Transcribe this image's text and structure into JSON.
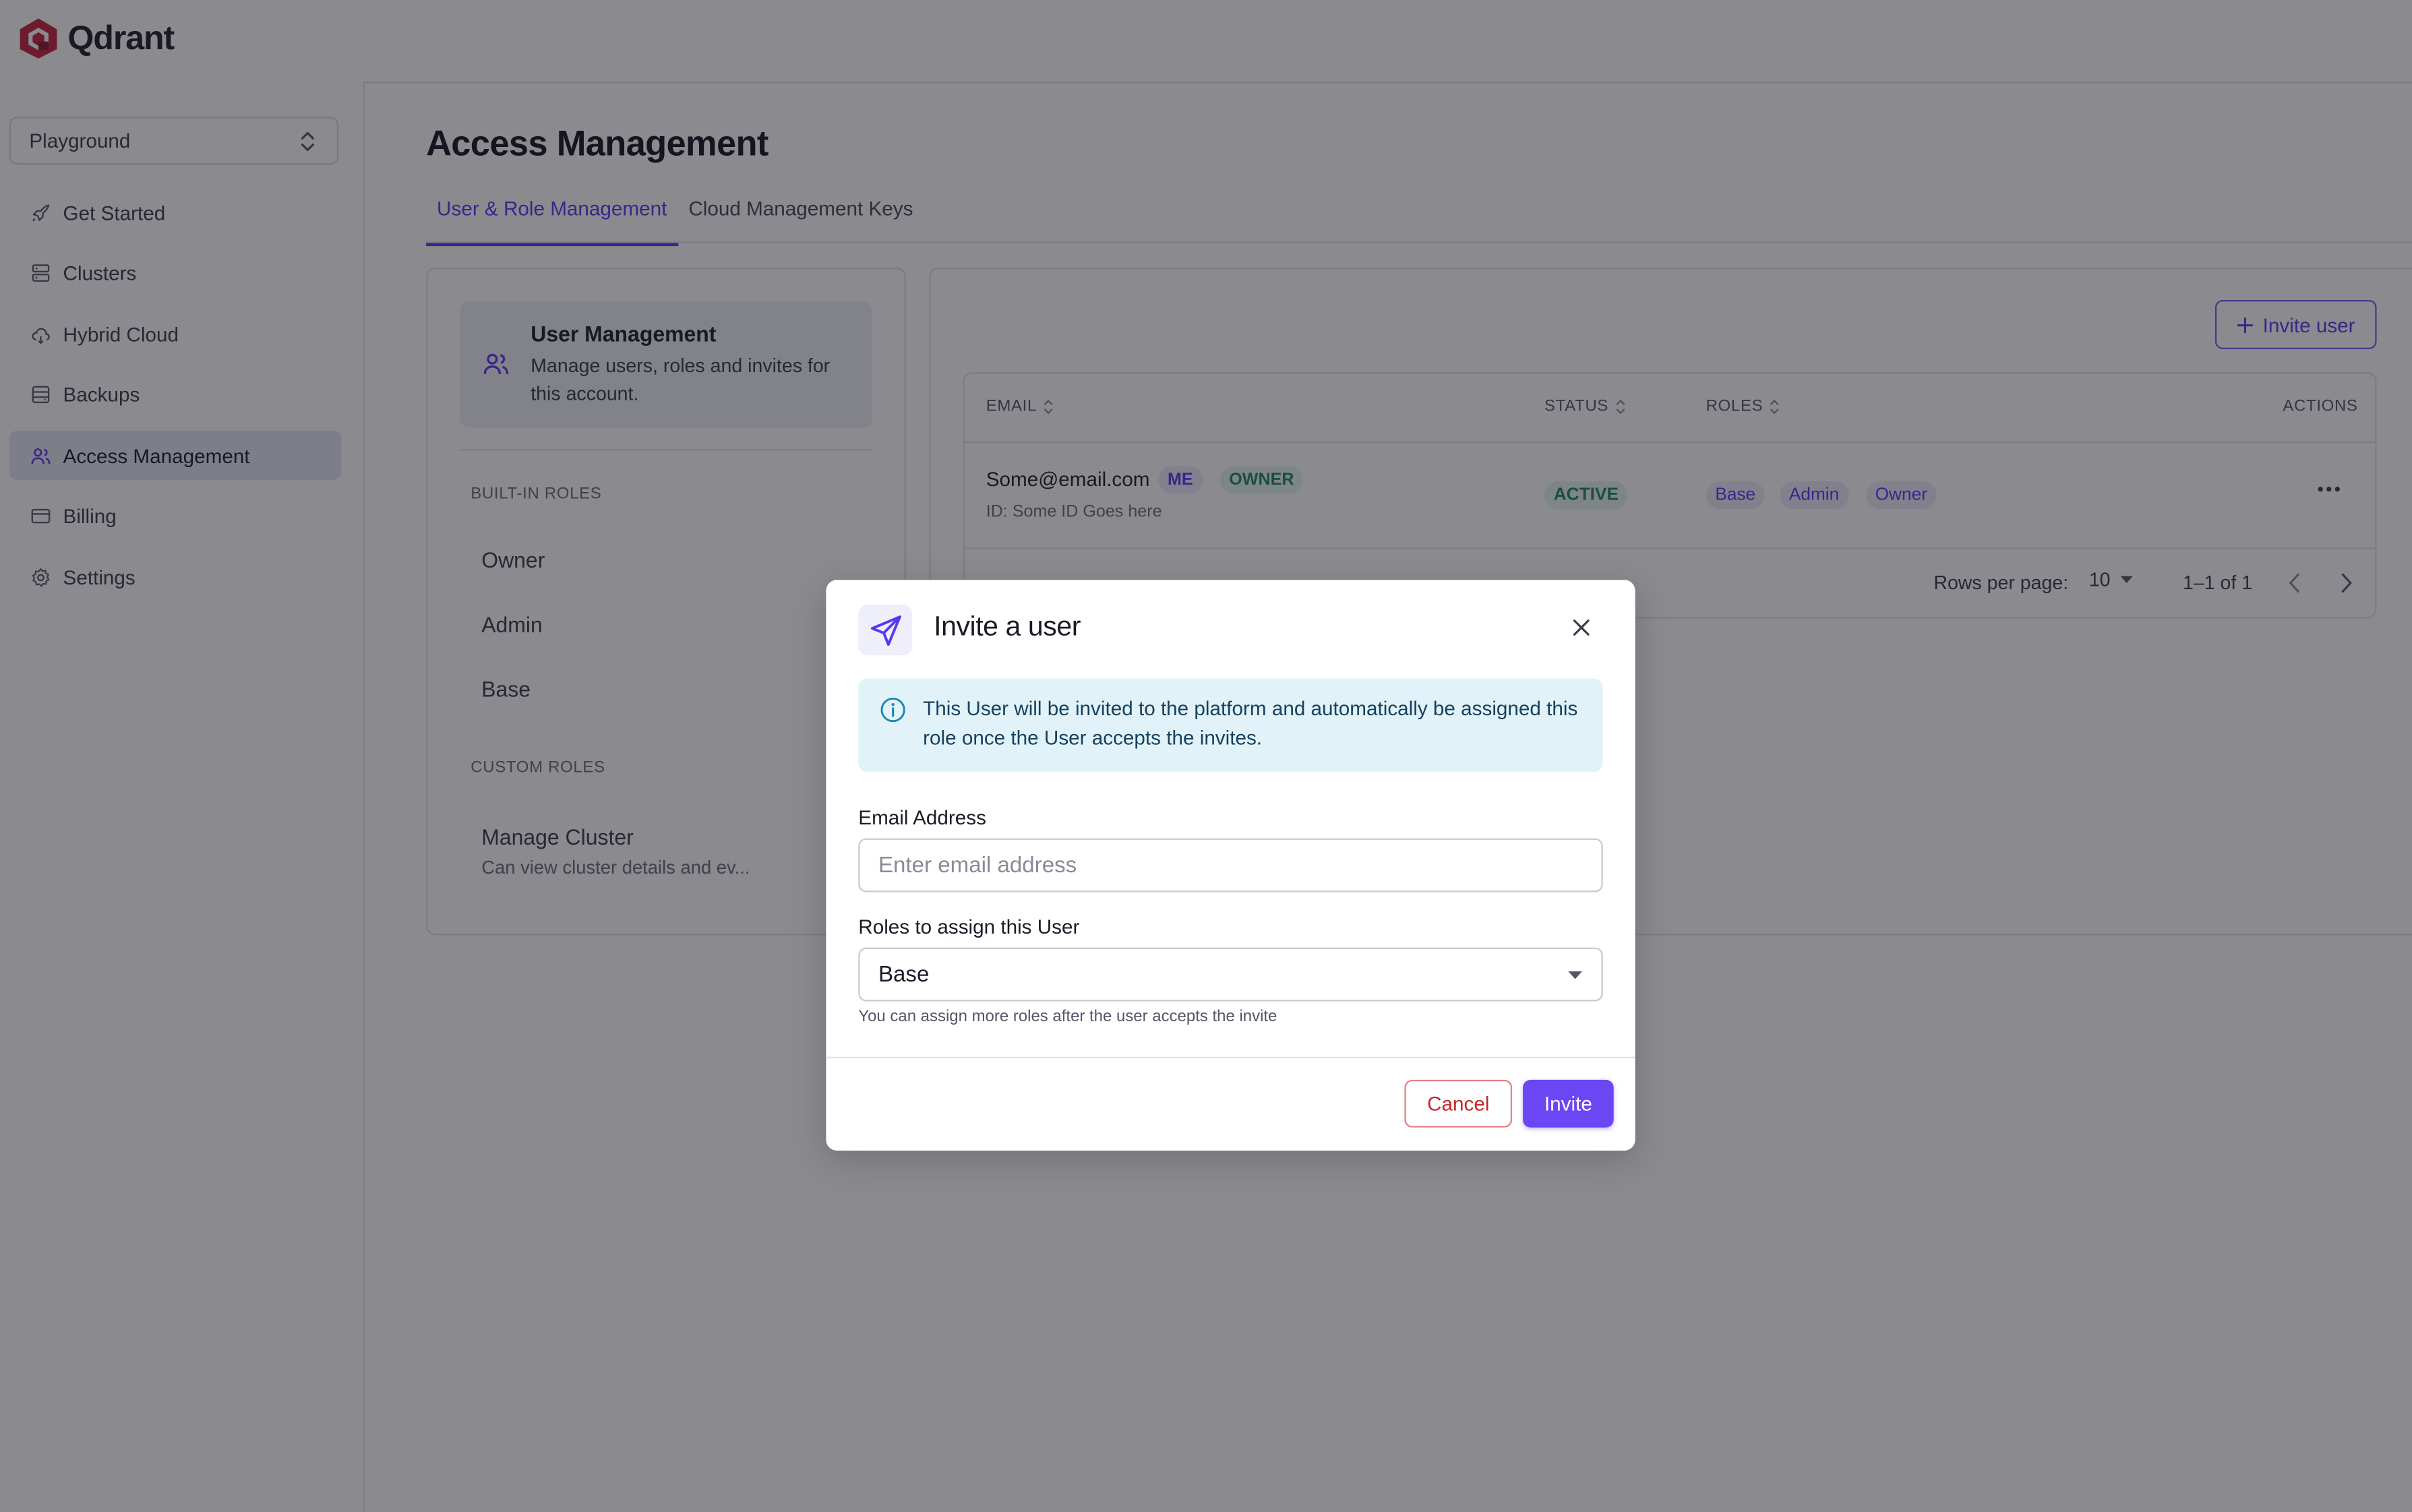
{
  "app": {
    "brand_name": "Qdrant"
  },
  "sidebar": {
    "workspace": "Playground",
    "items": [
      {
        "label": "Get Started",
        "icon": "rocket-icon",
        "active": false
      },
      {
        "label": "Clusters",
        "icon": "server-icon",
        "active": false
      },
      {
        "label": "Hybrid Cloud",
        "icon": "cloud-icon",
        "active": false
      },
      {
        "label": "Backups",
        "icon": "database-icon",
        "active": false
      },
      {
        "label": "Access Management",
        "icon": "users-icon",
        "active": true
      },
      {
        "label": "Billing",
        "icon": "credit-card-icon",
        "active": false
      },
      {
        "label": "Settings",
        "icon": "gear-icon",
        "active": false
      }
    ]
  },
  "page": {
    "title": "Access Management",
    "tabs": [
      {
        "label": "User & Role Management",
        "active": true
      },
      {
        "label": "Cloud Management Keys",
        "active": false
      }
    ]
  },
  "left_panel": {
    "card": {
      "title": "User Management",
      "description": "Manage users, roles and invites for this account."
    },
    "builtin_label": "BUILT-IN ROLES",
    "builtin_roles": [
      "Owner",
      "Admin",
      "Base"
    ],
    "custom_label": "CUSTOM ROLES",
    "custom_roles": [
      {
        "name": "Manage Cluster",
        "description": "Can view cluster details and ev..."
      }
    ]
  },
  "users_table": {
    "invite_button": "Invite user",
    "columns": {
      "email": "EMAIL",
      "status": "STATUS",
      "roles": "ROLES",
      "actions": "ACTIONS"
    },
    "rows": [
      {
        "email": "Some@email.com",
        "badges": [
          "ME",
          "OWNER"
        ],
        "id_text": "ID: Some ID Goes here",
        "status": "ACTIVE",
        "roles": [
          "Base",
          "Admin",
          "Owner"
        ]
      }
    ],
    "pagination": {
      "rows_per_page_label": "Rows per page:",
      "rows_per_page": "10",
      "range": "1–1 of 1"
    }
  },
  "modal": {
    "title": "Invite a user",
    "info": "This User will be invited to the platform and automatically be assigned this role once the User accepts the invites.",
    "email_label": "Email Address",
    "email_placeholder": "Enter email address",
    "email_value": "",
    "roles_label": "Roles to assign this User",
    "roles_value": "Base",
    "helper": "You can assign more roles after the user accepts the invite",
    "cancel": "Cancel",
    "invite": "Invite"
  },
  "colors": {
    "accent": "#5b36f2",
    "brand_logo": "#c4213c",
    "success": "#1d8a55",
    "danger": "#c8262a",
    "info_bg": "#e1f3f9"
  }
}
